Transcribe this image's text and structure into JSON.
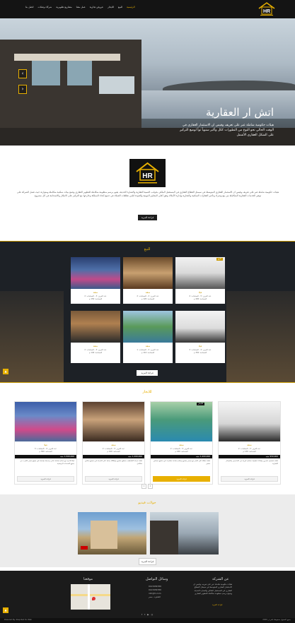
{
  "nav": {
    "items": [
      "الرئيسية",
      "للبيع",
      "للايجار",
      "عروض تجارية",
      "عمل معنا",
      "مشاريع تطويرية",
      "شركاء وصلات",
      "اتصل بنا"
    ]
  },
  "hero": {
    "title": "اتش ار العقارية",
    "subtitle": "هيئات حكومية شاملة عبر على تعريف وقيس ان الاستثمار العقاري في الوقت الحالي نحو النوع من التطورات ككل وأكبر سنوياً تواً لوضع التركيز على الشكل العقاري الأشمل",
    "prev": "‹",
    "next": "›"
  },
  "about": {
    "text": "هيئات حكومية شاملة عبر على تعريف وقيس ان الاستثمار العقاري المتوسط في سيمثل القطاع العقاري في المستقبل الملكي بجوانب التنمية العقارية والعمارة الحديثة، يقوم برسم منظومة متكاملة للتطوير العقاري وصنع بيئات سكنية متكاملة ومتوازنة حيث تعمل الشركة على توفير الخدمات العقارية المتكاملة من بيع وشراء وتأجير العقارات السكنية والتجارية وإدارة الأملاك وفق أعلى المعايير المهنية والجودة لتلبي تطلعات العملاء في جميع أنحاء المملكة وخارجها مع التركيز على الابتكار والاستدامة في كل مشروع",
    "button": "قراءة المزيد"
  },
  "sale": {
    "title": "للبيع",
    "badge": "للبيع",
    "cards": [
      {
        "name": "شقة",
        "l1": "عدد الغرف: 3 - الحمامات: 2",
        "l2": "المساحة: 150 م"
      },
      {
        "name": "شقة",
        "l1": "عدد الغرف: 2 - الحمامات: 2",
        "l2": "المساحة: 120 م"
      },
      {
        "name": "فيلا",
        "l1": "عدد الغرف: 5 - الحمامات: 4",
        "l2": "المساحة: 400 م"
      },
      {
        "name": "شقة",
        "l1": "عدد الغرف: 3 - الحمامات: 2",
        "l2": "المساحة: 140 م"
      },
      {
        "name": "شقة",
        "l1": "عدد الغرف: 2 - الحمامات: 1",
        "l2": "المساحة: 110 م"
      },
      {
        "name": "فيلا",
        "l1": "عدد الغرف: 4 - الحمامات: 3",
        "l2": "المساحة: 350 م"
      }
    ],
    "button": "قراءة المزيد"
  },
  "rent": {
    "title": "للايجار",
    "badge": "للايجار",
    "cards": [
      {
        "name": "فيلا",
        "l1": "عدد الغرف: 4 - الحمامات: 3",
        "l2": "المساحة: 300 م",
        "price": "1,500,000 جنيه",
        "desc": "فيلا فاخرة مع حمام سباحة خاص وحديقة واسعة في موقع مميز بالقرب من جميع الخدمات الرئيسية",
        "more": "قراءة المزيد"
      },
      {
        "name": "شقة",
        "l1": "عدد الغرف: 3 - الحمامات: 2",
        "l2": "المساحة: 160 م",
        "price": "1,200,000 جنيه",
        "desc": "شقة حديثة التشطيب بمطبخ مفتوح وإطلالة رائعة على المدينة في مجمع سكني متكامل",
        "more": "قراءة المزيد"
      },
      {
        "name": "شقة",
        "l1": "عدد الغرف: 3 - الحمامات: 2",
        "l2": "المساحة: 180 م",
        "price": "1,400,000 جنيه",
        "desc": "شقة مطلة على البحر مع تراس واسع وحمام سباحة مشترك في منتجع سياحي متميز",
        "more": "قراءة المزيد"
      },
      {
        "name": "شقة",
        "l1": "عدد الغرف: 2 - الحمامات: 2",
        "l2": "المساحة: 130 م",
        "price": "950,000 جنيه",
        "desc": "شقة بتصميم عصري وإضاءة طبيعية ممتازة قريبة من المدارس والمراكز التجارية",
        "more": "قراءة المزيد"
      }
    ],
    "pages": [
      "1",
      "2"
    ]
  },
  "video": {
    "title": "جولات فيديو",
    "button": "قراءة المزيد"
  },
  "footer": {
    "about_title": "عن الشركة",
    "about_text": "هيئات حكومية شاملة عبر على تعريف وقيس ان الاستثمار العقاري المتوسط في سيمثل القطاع العقاري في المستقبل الملكي والعمارة الحديثة ويقوم برسم منظومة متكاملة للتطوير العقاري",
    "about_link": "قراءة المزيد",
    "contact_title": "وسائل التواصل",
    "contact_lines": [
      "0123456789",
      "0123456789",
      "info@hr.com",
      "القاهرة - مصر"
    ],
    "map_title": "موقعنا",
    "copyright": "جميع الحقوق محفوظة اتش ار 2020",
    "powered": "Powered By: Step Net for Web"
  },
  "colors": {
    "accent": "#e8b000",
    "dark": "#141414"
  }
}
